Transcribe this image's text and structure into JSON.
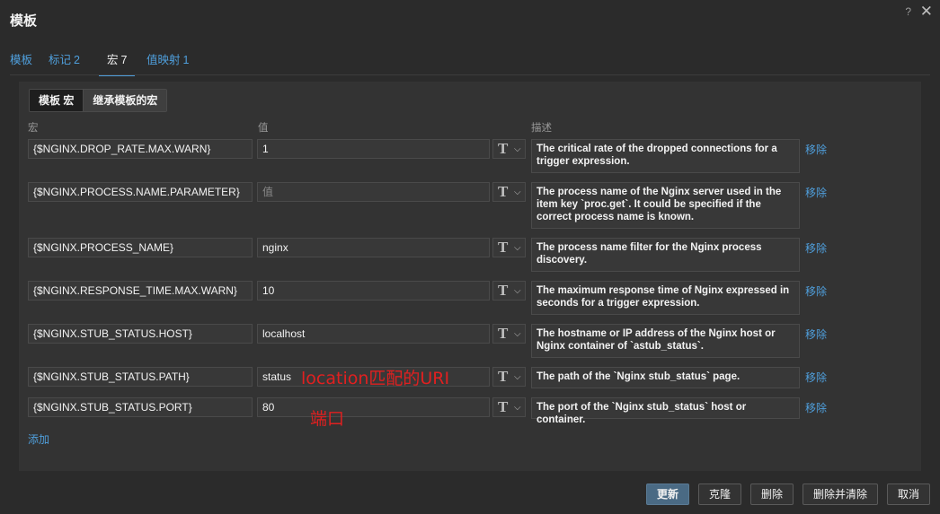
{
  "window": {
    "title": "模板",
    "help_glyph": "?",
    "close_glyph": "✕"
  },
  "tabs": [
    {
      "label": "模板",
      "count": ""
    },
    {
      "label": "标记",
      "count": "2"
    },
    {
      "label": "宏",
      "count": "7"
    },
    {
      "label": "值映射",
      "count": "1"
    }
  ],
  "active_tab": "宏",
  "macro_scope": {
    "own_label": "模板 宏",
    "inherited_label": "继承模板的宏"
  },
  "columns": {
    "macro": "宏",
    "value": "值",
    "description": "描述"
  },
  "macros": [
    {
      "macro": "{$NGINX.DROP_RATE.MAX.WARN}",
      "value": "1",
      "placeholder": "",
      "type": "T",
      "description": "The critical rate of the dropped connections for a trigger expression.",
      "remove": "移除"
    },
    {
      "macro": "{$NGINX.PROCESS.NAME.PARAMETER}",
      "value": "",
      "placeholder": "值",
      "type": "T",
      "description": "The process name of the Nginx server used in the item key `proc.get`. It could be specified if the correct process name is known.",
      "remove": "移除"
    },
    {
      "macro": "{$NGINX.PROCESS_NAME}",
      "value": "nginx",
      "placeholder": "",
      "type": "T",
      "description": "The process name filter for the Nginx process discovery.",
      "remove": "移除"
    },
    {
      "macro": "{$NGINX.RESPONSE_TIME.MAX.WARN}",
      "value": "10",
      "placeholder": "",
      "type": "T",
      "description": "The maximum response time of Nginx expressed in seconds for a trigger expression.",
      "remove": "移除"
    },
    {
      "macro": "{$NGINX.STUB_STATUS.HOST}",
      "value": "localhost",
      "placeholder": "",
      "type": "T",
      "description": "The hostname or IP address of the Nginx host or Nginx container of `astub_status`.",
      "remove": "移除"
    },
    {
      "macro": "{$NGINX.STUB_STATUS.PATH}",
      "value": "status",
      "placeholder": "",
      "type": "T",
      "description": "The path of the `Nginx stub_status` page.",
      "remove": "移除"
    },
    {
      "macro": "{$NGINX.STUB_STATUS.PORT}",
      "value": "80",
      "placeholder": "",
      "type": "T",
      "description": "The port of the `Nginx stub_status` host or container.",
      "remove": "移除"
    }
  ],
  "add_label": "添加",
  "annotations": {
    "path_note": "location匹配的URI",
    "port_note": "端口"
  },
  "footer": {
    "update": "更新",
    "clone": "克隆",
    "delete": "删除",
    "delete_clear": "删除并清除",
    "cancel": "取消"
  },
  "colors": {
    "accent": "#4f9fdc",
    "annotation": "#e02020",
    "primary_button": "#4a6a84"
  }
}
